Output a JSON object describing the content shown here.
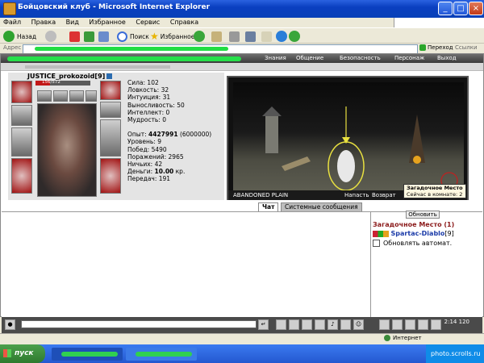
{
  "window": {
    "title": "Бойцовский клуб - Microsoft Internet Explorer"
  },
  "menu": [
    "Файл",
    "Правка",
    "Вид",
    "Избранное",
    "Сервис",
    "Справка"
  ],
  "toolbar": {
    "back": "Назад",
    "search": "Поиск",
    "favorites": "Избранное"
  },
  "address": {
    "label": "Адрес",
    "go": "Переход",
    "links": "Ссылки"
  },
  "game_nav": [
    "Знания",
    "Общение",
    "Безопасность",
    "Персонаж",
    "Выход"
  ],
  "character": {
    "name": "JUSTICE_prokozoid",
    "level": "[9]",
    "hp_text": "156/572",
    "hp_fraction": 0.27,
    "stats": [
      {
        "label": "Сила:",
        "value": "102"
      },
      {
        "label": "Ловкость:",
        "value": "32"
      },
      {
        "label": "Интуиция:",
        "value": "31"
      },
      {
        "label": "Выносливость:",
        "value": "50"
      },
      {
        "label": "Интеллект:",
        "value": "0"
      },
      {
        "label": "Мудрость:",
        "value": "0"
      }
    ],
    "exp_label": "Опыт:",
    "exp_value": "4427991",
    "exp_next": "(6000000)",
    "details": [
      {
        "label": "Уровень:",
        "value": "9"
      },
      {
        "label": "Побед:",
        "value": "5490"
      },
      {
        "label": "Поражений:",
        "value": "2965"
      },
      {
        "label": "Ничьих:",
        "value": "42"
      }
    ],
    "money_label": "Деньги:",
    "money_value": "10.00",
    "money_unit": "кр.",
    "transfers_label": "Передач:",
    "transfers_value": "191"
  },
  "scene": {
    "location": "ABANDONED PLAIN",
    "attack": "Напасть",
    "return": "Возврат",
    "tooltip_title": "Загадочное Место",
    "tooltip_text": "Сейчас в комнате: 2"
  },
  "tabs": {
    "chat": "Чат",
    "system": "Системные сообщения"
  },
  "room": {
    "refresh": "Обновить",
    "name": "Загадочное Место (1)",
    "player": "Spartac-Diablo",
    "player_level": "[9]",
    "auto_refresh": "Обновлять автомат."
  },
  "clock": {
    "time": "2:14",
    "sub": "120"
  },
  "status": {
    "zone": "Интернет"
  },
  "taskbar": {
    "start": "пуск",
    "tray": "photo.scrolls.ru"
  }
}
